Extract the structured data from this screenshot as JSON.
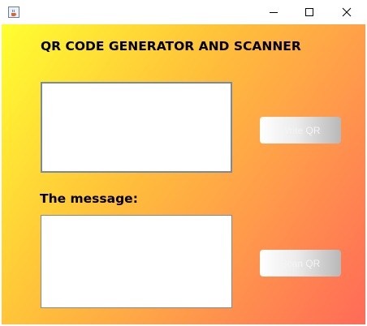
{
  "window": {
    "icon": "java-cup-icon",
    "controls": {
      "minimize_icon": "minimize-icon",
      "maximize_icon": "maximize-icon",
      "close_icon": "close-icon"
    }
  },
  "main": {
    "heading": "QR CODE GENERATOR AND SCANNER",
    "input_value": "",
    "message_label": "The message:",
    "output_value": "",
    "write_button_label": "Write QR",
    "scan_button_label": "Scan QR"
  },
  "colors": {
    "gradient_start": "#ffff30",
    "gradient_end": "#ff6a58",
    "button_text": "#f4f4f4"
  }
}
